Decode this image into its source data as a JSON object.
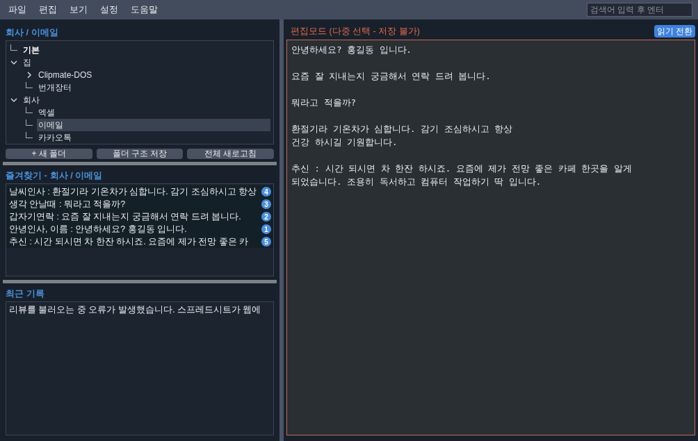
{
  "menu": [
    "파일",
    "편집",
    "보기",
    "설정",
    "도움말"
  ],
  "search": {
    "placeholder": "검색어 입력 후 엔터"
  },
  "folder_panel": {
    "title": "회사 / 이메일",
    "tree": [
      {
        "label": "기본",
        "kind": "leaf",
        "bold": true,
        "selected": false
      },
      {
        "label": "집",
        "kind": "folder",
        "expanded": true,
        "selected": false,
        "children": [
          {
            "label": "Clipmate-DOS",
            "kind": "folder",
            "expanded": false,
            "selected": false
          },
          {
            "label": "번개장터",
            "kind": "leaf",
            "selected": false
          }
        ]
      },
      {
        "label": "회사",
        "kind": "folder",
        "expanded": true,
        "selected": false,
        "children": [
          {
            "label": "엑셀",
            "kind": "leaf",
            "selected": false
          },
          {
            "label": "이메일",
            "kind": "leaf",
            "selected": true
          },
          {
            "label": "카카오톡",
            "kind": "leaf",
            "selected": false
          }
        ]
      }
    ],
    "buttons": [
      "+ 새 폴더",
      "폴더 구조 저장",
      "전체 새로고침"
    ]
  },
  "favorites": {
    "title": "즐겨찾기 - 회사 / 이메일",
    "items": [
      {
        "text": "날씨인사 : 환절기라 기온차가 심합니다. 감기 조심하시고 항상",
        "badge": "4"
      },
      {
        "text": "생각 안날때 : 뭐라고 적을까?",
        "badge": "3"
      },
      {
        "text": "갑자기연락 : 요즘 잘 지내는지 궁금해서 연락 드려 봅니다.",
        "badge": "2"
      },
      {
        "text": "안녕인사, 이름 : 안녕하세요? 홍길동 입니다.",
        "badge": "1"
      },
      {
        "text": "추신 : 시간 되시면 차 한잔 하시죠. 요즘에 제가 전망 좋은 카",
        "badge": "5"
      }
    ]
  },
  "history": {
    "title": "최근 기록",
    "items": [
      "리뷰를 불러오는 중 오류가 발생했습니다. 스프레드시트가 웹에"
    ]
  },
  "editor": {
    "title": "편집모드 (다중 선택 - 저장 불가)",
    "toggle_button": "읽기 전환",
    "paragraphs": [
      [
        "안녕하세요? 홍길동 입니다."
      ],
      [
        "요즘 잘 지내는지 궁금해서 연락 드려 봅니다."
      ],
      [
        "뭐라고 적을까?"
      ],
      [
        "환절기라 기온차가 심합니다. 감기 조심하시고 항상",
        "건강 하시길 기원합니다."
      ],
      [
        "추신 : 시간 되시면 차 한잔 하시죠. 요즘에 제가 전망 좋은 카페 한곳을 알게",
        "되었습니다. 조용히 독서하고 컴퓨터 작업하기 딱 입니다."
      ]
    ]
  }
}
